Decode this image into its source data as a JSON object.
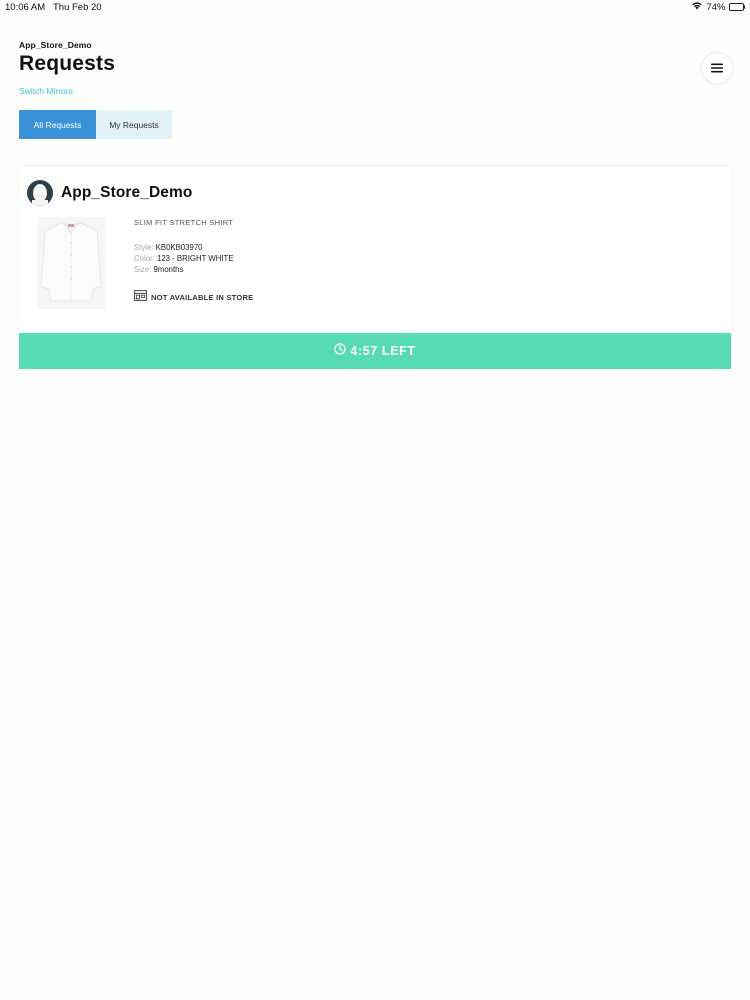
{
  "status_bar": {
    "time": "10:06 AM",
    "date": "Thu Feb 20",
    "battery_percent": "74%",
    "battery_level": 0.74,
    "icons": [
      "wifi-icon",
      "battery-icon"
    ]
  },
  "header": {
    "store_name": "App_Store_Demo",
    "title": "Requests",
    "switch_link": "Switch Mirrors",
    "menu_icon": "hamburger-menu-icon"
  },
  "tabs": [
    {
      "label": "All Requests",
      "active": true
    },
    {
      "label": "My Requests",
      "active": false
    }
  ],
  "request_card": {
    "store_name": "App_Store_Demo",
    "avatar_icon": "user-avatar-icon",
    "product": {
      "name": "SLIM FIT STRETCH SHIRT",
      "style_label": "Style:",
      "style_value": "KB0KB03970",
      "color_label": "Color:",
      "color_value": "123 - BRIGHT WHITE",
      "size_label": "Size:",
      "size_value": "9months",
      "availability": "NOT AVAILABLE IN STORE",
      "availability_icon": "store-icon"
    },
    "timer": {
      "label": "4:57 LEFT",
      "icon": "clock-icon"
    }
  },
  "colors": {
    "accent_blue": "#3a92d8",
    "tab_inactive_bg": "#e0f1f8",
    "link_cyan": "#3cc4d6",
    "timer_green": "#56dbb5"
  }
}
